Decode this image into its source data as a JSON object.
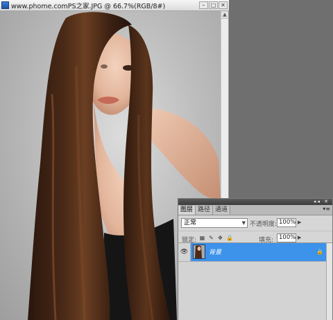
{
  "document": {
    "title": "www.phome.comPS之家.JPG @ 66.7%(RGB/8#)",
    "window_buttons": [
      "minimize",
      "maximize",
      "close"
    ]
  },
  "layers_panel": {
    "tabs": [
      "图层",
      "路径",
      "通道"
    ],
    "active_tab": "图层",
    "blend_mode": "正常",
    "opacity_label": "不透明度:",
    "opacity_value": "100%",
    "lock_label": "锁定:",
    "fill_label": "填充:",
    "fill_value": "100%",
    "layers": [
      {
        "name": "背景",
        "visible": true,
        "locked": true,
        "selected": true
      }
    ]
  },
  "colors": {
    "selection": "#3d92ea",
    "workspace": "#6f6f6f",
    "panel": "#d6d6d6"
  },
  "icons": [
    "ps-doc-icon",
    "eye-icon",
    "lock-icon",
    "brush-icon",
    "move-icon",
    "checker-lock-icon"
  ]
}
